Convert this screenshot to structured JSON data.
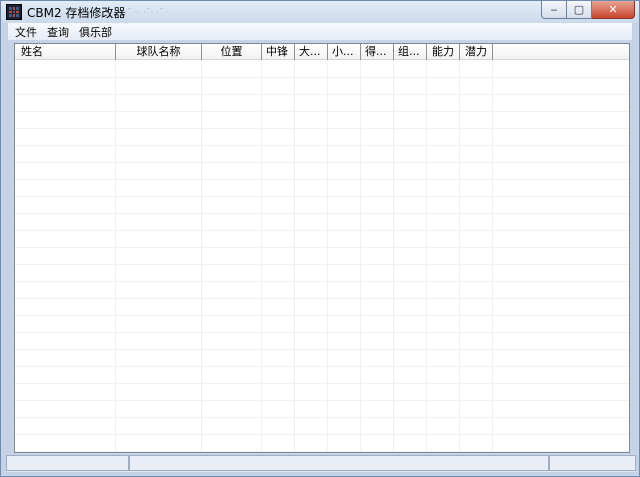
{
  "window": {
    "title": "CBM2 存档修改器",
    "title_ghost": "ˉ˙ ·· ··ˉ ·· ·ˉ· ·ˉ ·",
    "minimize_glyph": "‒",
    "maximize_glyph": "▢",
    "close_glyph": "✕"
  },
  "menu": {
    "items": [
      {
        "label": "文件"
      },
      {
        "label": "查询"
      },
      {
        "label": "俱乐部"
      }
    ]
  },
  "list": {
    "columns": [
      {
        "label": "姓名",
        "align": "left"
      },
      {
        "label": "球队名称",
        "align": "center"
      },
      {
        "label": "位置",
        "align": "center"
      },
      {
        "label": "中锋",
        "align": "left"
      },
      {
        "label": "大...",
        "align": "left"
      },
      {
        "label": "小...",
        "align": "left"
      },
      {
        "label": "得...",
        "align": "left"
      },
      {
        "label": "组...",
        "align": "left"
      },
      {
        "label": "能力",
        "align": "left"
      },
      {
        "label": "潜力",
        "align": "left"
      }
    ],
    "rows": []
  },
  "status": {
    "pane1": "",
    "pane2": "",
    "pane3": ""
  }
}
